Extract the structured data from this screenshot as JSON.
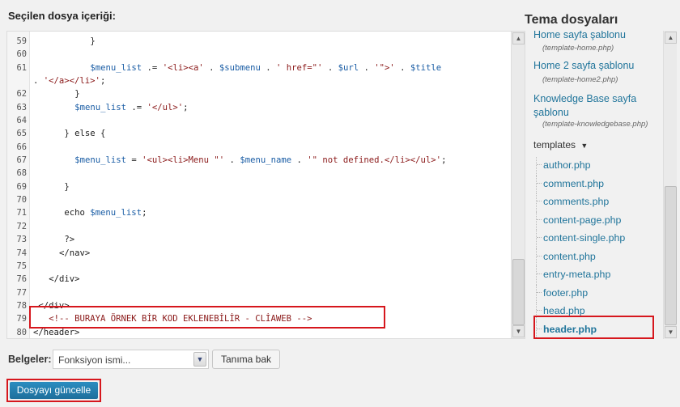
{
  "editor": {
    "section_title": "Seçilen dosya içeriği:",
    "lines": [
      {
        "num": "59",
        "indent": 11,
        "parts": [
          {
            "t": "}",
            "c": ""
          }
        ]
      },
      {
        "num": "60",
        "indent": 0,
        "parts": []
      },
      {
        "num": "61",
        "indent": 11,
        "parts": [
          {
            "t": "$menu_list",
            "c": "var"
          },
          {
            "t": " .= ",
            "c": ""
          },
          {
            "t": "'<li><a'",
            "c": "str"
          },
          {
            "t": " . ",
            "c": ""
          },
          {
            "t": "$submenu",
            "c": "var"
          },
          {
            "t": " . ",
            "c": ""
          },
          {
            "t": "' href=\"'",
            "c": "str"
          },
          {
            "t": " . ",
            "c": ""
          },
          {
            "t": "$url",
            "c": "var"
          },
          {
            "t": " . ",
            "c": ""
          },
          {
            "t": "'\">'",
            "c": "str"
          },
          {
            "t": " . ",
            "c": ""
          },
          {
            "t": "$title",
            "c": "var"
          }
        ],
        "wrap": [
          {
            "t": ". ",
            "c": ""
          },
          {
            "t": "'</a></li>'",
            "c": "str"
          },
          {
            "t": ";",
            "c": ""
          }
        ]
      },
      {
        "num": "62",
        "indent": 8,
        "parts": [
          {
            "t": "}",
            "c": ""
          }
        ]
      },
      {
        "num": "63",
        "indent": 8,
        "parts": [
          {
            "t": "$menu_list",
            "c": "var"
          },
          {
            "t": " .= ",
            "c": ""
          },
          {
            "t": "'</ul>'",
            "c": "str"
          },
          {
            "t": ";",
            "c": ""
          }
        ]
      },
      {
        "num": "64",
        "indent": 0,
        "parts": []
      },
      {
        "num": "65",
        "indent": 6,
        "parts": [
          {
            "t": "} else {",
            "c": ""
          }
        ]
      },
      {
        "num": "66",
        "indent": 0,
        "parts": []
      },
      {
        "num": "67",
        "indent": 8,
        "parts": [
          {
            "t": "$menu_list",
            "c": "var"
          },
          {
            "t": " = ",
            "c": ""
          },
          {
            "t": "'<ul><li>Menu \"'",
            "c": "str"
          },
          {
            "t": " . ",
            "c": ""
          },
          {
            "t": "$menu_name",
            "c": "var"
          },
          {
            "t": " . ",
            "c": ""
          },
          {
            "t": "'\" not defined.</li></ul>'",
            "c": "str"
          },
          {
            "t": ";",
            "c": ""
          }
        ]
      },
      {
        "num": "68",
        "indent": 0,
        "parts": []
      },
      {
        "num": "69",
        "indent": 6,
        "parts": [
          {
            "t": "}",
            "c": ""
          }
        ]
      },
      {
        "num": "70",
        "indent": 0,
        "parts": []
      },
      {
        "num": "71",
        "indent": 6,
        "parts": [
          {
            "t": "echo ",
            "c": ""
          },
          {
            "t": "$menu_list",
            "c": "var"
          },
          {
            "t": ";",
            "c": ""
          }
        ]
      },
      {
        "num": "72",
        "indent": 0,
        "parts": []
      },
      {
        "num": "73",
        "indent": 6,
        "parts": [
          {
            "t": "?>",
            "c": ""
          }
        ]
      },
      {
        "num": "74",
        "indent": 5,
        "parts": [
          {
            "t": "</nav>",
            "c": ""
          }
        ]
      },
      {
        "num": "75",
        "indent": 0,
        "parts": []
      },
      {
        "num": "76",
        "indent": 3,
        "parts": [
          {
            "t": "</div>",
            "c": ""
          }
        ]
      },
      {
        "num": "77",
        "indent": 0,
        "parts": []
      },
      {
        "num": "78",
        "indent": 1,
        "parts": [
          {
            "t": "</div>",
            "c": ""
          }
        ]
      },
      {
        "num": "79",
        "indent": 3,
        "parts": [
          {
            "t": "<!-- BURAYA ÖRNEK BİR KOD EKLENEBİLİR - CLİAWEB -->",
            "c": "str"
          }
        ]
      },
      {
        "num": "80",
        "indent": 0,
        "parts": [
          {
            "t": "</header>",
            "c": ""
          }
        ]
      }
    ]
  },
  "files": {
    "title": "Tema dosyaları",
    "templates_top": [
      {
        "label": "Home sayfa şablonu",
        "file": "(template-home.php)"
      },
      {
        "label": "Home 2 sayfa şablonu",
        "file": "(template-home2.php)"
      },
      {
        "label": "Knowledge Base sayfa şablonu",
        "file": "(template-knowledgebase.php)"
      }
    ],
    "group_label": "templates",
    "group_arrow": "▼",
    "items": [
      "author.php",
      "comment.php",
      "comments.php",
      "content-page.php",
      "content-single.php",
      "content.php",
      "entry-meta.php",
      "footer.php",
      "head.php",
      "header.php"
    ],
    "active_item": "header.php"
  },
  "docs": {
    "label": "Belgeler:",
    "select_value": "Fonksiyon ismi...",
    "lookup_button": "Tanıma bak"
  },
  "update_button": "Dosyayı güncelle",
  "colors": {
    "link": "#21759b",
    "highlight_border": "#d6171d",
    "primary_button": "#1e6f9c"
  }
}
